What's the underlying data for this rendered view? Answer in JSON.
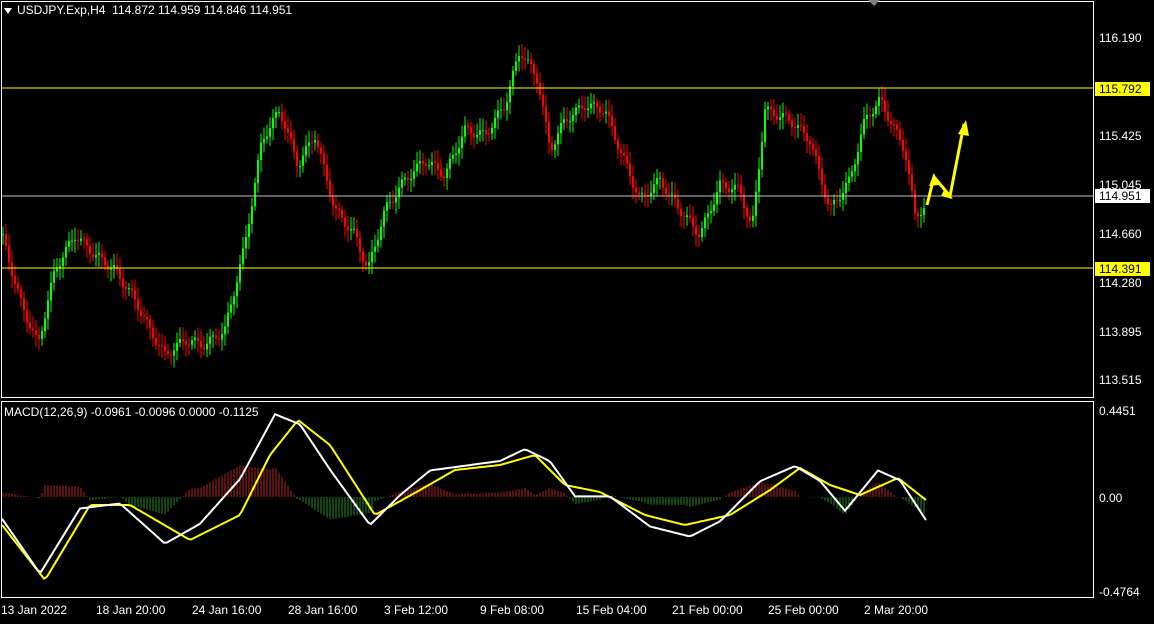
{
  "header": {
    "symbol": "USDJPY.Exp,H4",
    "ohlc": "114.872 114.959 114.846 114.951"
  },
  "price_axis": {
    "ticks": [
      "116.190",
      "115.425",
      "115.045",
      "114.660",
      "114.280",
      "113.895",
      "113.515"
    ],
    "level_high": "115.792",
    "level_low": "114.391",
    "current": "114.951"
  },
  "macd": {
    "label": "MACD(12,26,9) -0.0961 -0.0096 0.0000 -0.1125",
    "ticks": [
      "0.4451",
      "0.00",
      "-0.4764"
    ]
  },
  "time_axis": {
    "labels": [
      "13 Jan 2022",
      "18 Jan 20:00",
      "24 Jan 16:00",
      "28 Jan 16:00",
      "3 Feb 12:00",
      "9 Feb 08:00",
      "15 Feb 04:00",
      "21 Feb 00:00",
      "25 Feb 00:00",
      "2 Mar 20:00"
    ]
  },
  "colors": {
    "background": "#000000",
    "bull": "#00ff00",
    "bear": "#ff0000",
    "level_line": "#ffff00",
    "current_line": "#c0c0c0",
    "macd_line": "#ffffff",
    "signal_line": "#ffff00",
    "hist_pos": "#b22222",
    "hist_neg": "#228b22"
  }
}
